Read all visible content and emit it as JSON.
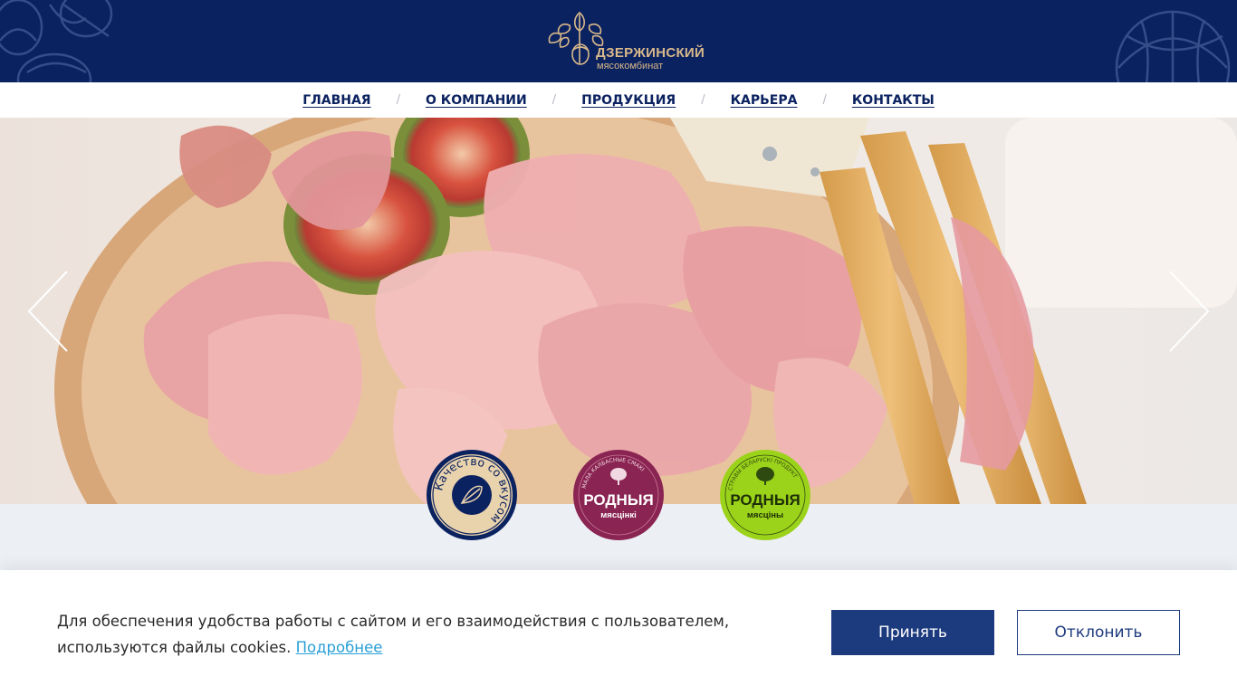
{
  "colors": {
    "header_bg": "#0b2260",
    "logo_gold": "#d9b98a",
    "accent_blue": "#1c3a7e",
    "link_blue": "#2a9fd8",
    "badge_1": "#0b2260",
    "badge_2": "#8a2452",
    "badge_3": "#9bd21a"
  },
  "header": {
    "logo": {
      "name": "ДЗЕРЖИНСКИЙ",
      "subtitle": "мясокомбинат",
      "icon": "oak-leaves-acorn-icon"
    }
  },
  "nav": {
    "items": [
      {
        "label": "ГЛАВНАЯ"
      },
      {
        "label": "О КОМПАНИИ"
      },
      {
        "label": "ПРОДУКЦИЯ"
      },
      {
        "label": "КАРЬЕРА"
      },
      {
        "label": "КОНТАКТЫ"
      }
    ],
    "separator": "/"
  },
  "hero": {
    "prev_icon": "chevron-left-icon",
    "next_icon": "chevron-right-icon"
  },
  "brands": [
    {
      "text": "Качество со вкусом",
      "icon": "oak-leaf-icon"
    },
    {
      "top": "МАЛА КАЛБАСНЫЕ СМАКІ",
      "title": "РОДНЫЯ",
      "sub": "мясцінкі"
    },
    {
      "top": "СТРАВЫ БЕЛАРУСКІ ПРОДУКТ",
      "title": "РОДНЫЯ",
      "sub": "мясцiны"
    }
  ],
  "cookie": {
    "text": "Для обеспечения удобства работы с сайтом и его взаимодействия с пользователем, используются файлы cookies.",
    "link": "Подробнее",
    "accept": "Принять",
    "decline": "Отклонить"
  }
}
